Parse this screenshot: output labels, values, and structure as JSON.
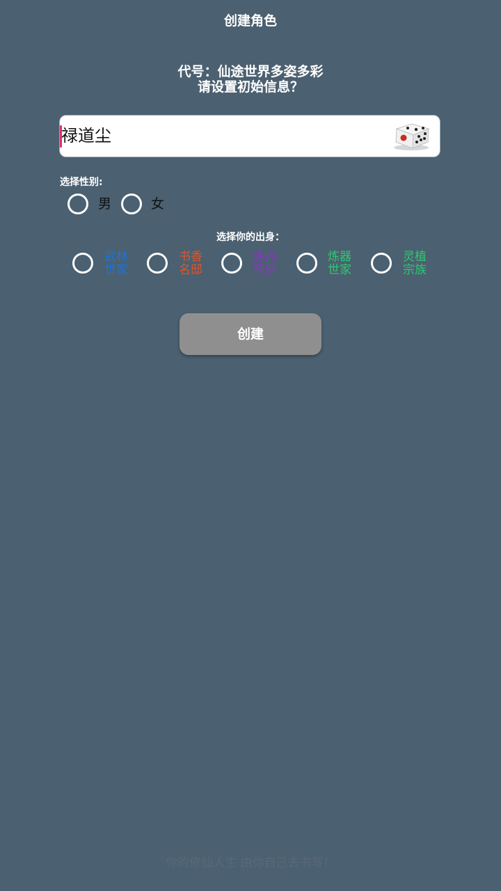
{
  "header": {
    "title": "创建角色"
  },
  "prompt": {
    "line1": "代号：仙途世界多姿多彩",
    "line2": "请设置初始信息？"
  },
  "name_field": {
    "value": "禄道尘",
    "dice_icon": "dice-icon"
  },
  "gender": {
    "label": "选择性别:",
    "options": [
      {
        "label": "男",
        "selected": false
      },
      {
        "label": "女",
        "selected": false
      }
    ]
  },
  "origin": {
    "label": "选择你的出身：",
    "options": [
      {
        "line1": "武林",
        "line2": "世家",
        "color": "#1e73d8",
        "selected": false
      },
      {
        "line1": "书香",
        "line2": "名邸",
        "color": "#e0552a",
        "selected": false
      },
      {
        "line1": "炼丹",
        "line2": "药庐",
        "color": "#8a35c8",
        "selected": false
      },
      {
        "line1": "炼器",
        "line2": "世家",
        "color": "#2ec870",
        "selected": false
      },
      {
        "line1": "灵植",
        "line2": "宗族",
        "color": "#2ec870",
        "selected": false
      }
    ]
  },
  "actions": {
    "create_label": "创建"
  },
  "footer": {
    "text": "你的修仙人生 由你自己去书写！"
  },
  "colors": {
    "background": "#4b6070",
    "button": "#8f8f8f",
    "caret": "#e0306a"
  }
}
